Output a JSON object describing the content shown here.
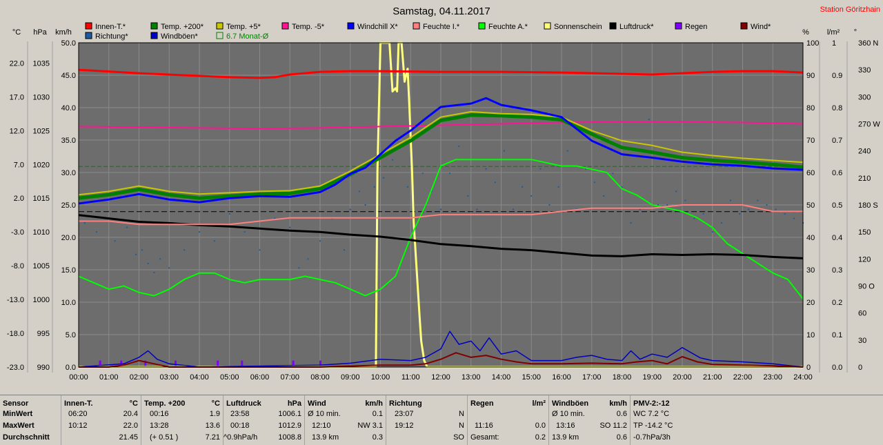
{
  "title": "Samstag, 04.11.2017",
  "station": "Station Göritzhain",
  "colors": {
    "plot_bg": "#6d6d6d",
    "grid": "#8a8a8a",
    "innen": "#ff0000",
    "temp200": "#008000",
    "temp5": "#c8c800",
    "tempm5": "#ff1493",
    "windchill": "#0000ff",
    "feuchte_i": "#ff8080",
    "feuchte_a": "#00ff00",
    "sonne": "#ffff80",
    "luftdruck": "#000000",
    "regen": "#8000ff",
    "wind": "#800000",
    "richtung": "#1e5aa0",
    "windboeen": "#0000c0",
    "monat": "#008000"
  },
  "legend": [
    {
      "label": "Innen-T.*",
      "color": "#ff0000"
    },
    {
      "label": "Temp. +200*",
      "color": "#008000"
    },
    {
      "label": "Temp. +5*",
      "color": "#c8c800"
    },
    {
      "label": "Temp. -5*",
      "color": "#ff1493"
    },
    {
      "label": "Windchill X*",
      "color": "#0000ff"
    },
    {
      "label": "Feuchte I.*",
      "color": "#ff8080"
    },
    {
      "label": "Feuchte A.*",
      "color": "#00ff00"
    },
    {
      "label": "Sonnenschein",
      "color": "#ffff80"
    },
    {
      "label": "Luftdruck*",
      "color": "#000000"
    },
    {
      "label": "Regen",
      "color": "#8000ff"
    },
    {
      "label": "Wind*",
      "color": "#800000"
    },
    {
      "label": "Richtung*",
      "color": "#1e5aa0"
    },
    {
      "label": "Windböen*",
      "color": "#0000c0"
    },
    {
      "label": "6.7 Monat-Ø",
      "color": "#008000",
      "outline": true
    }
  ],
  "axis_units": {
    "temp": "°C",
    "pressure": "hPa",
    "wind": "km/h",
    "percent": "%",
    "rain": "l/m²",
    "degree": "°"
  },
  "chart_data": {
    "type": "line",
    "x_ticks": [
      "00:00",
      "01:00",
      "02:00",
      "03:00",
      "04:00",
      "05:00",
      "06:00",
      "07:00",
      "08:00",
      "09:00",
      "10:00",
      "11:00",
      "12:00",
      "13:00",
      "14:00",
      "15:00",
      "16:00",
      "17:00",
      "18:00",
      "19:00",
      "20:00",
      "21:00",
      "22:00",
      "23:00",
      "24:00"
    ],
    "xlim": [
      0,
      24
    ],
    "temp_ticks": [
      "22.0",
      "17.0",
      "12.0",
      "7.0",
      "2.0",
      "-3.0",
      "-8.0",
      "-13.0",
      "-18.0",
      "-23.0"
    ],
    "temp_lim": [
      -23,
      25
    ],
    "pressure_ticks": [
      "1035",
      "1030",
      "1025",
      "1020",
      "1015",
      "1010",
      "1005",
      "1000",
      "995",
      "990"
    ],
    "pressure_lim": [
      990,
      1038
    ],
    "wind_ticks": [
      "50.0",
      "45.0",
      "40.0",
      "35.0",
      "30.0",
      "25.0",
      "20.0",
      "15.0",
      "10.0",
      "5.0",
      "0.0"
    ],
    "wind_lim": [
      0,
      50
    ],
    "percent_ticks": [
      "100",
      "90",
      "80",
      "70",
      "60",
      "50",
      "40",
      "30",
      "20",
      "10",
      "0"
    ],
    "percent_lim": [
      0,
      100
    ],
    "rain_ticks": [
      "1",
      "0.9",
      "0.8",
      "0.7",
      "0.6",
      "0.5",
      "0.4",
      "0.3",
      "0.2",
      "0.1",
      "0.0"
    ],
    "rain_lim": [
      0,
      1
    ],
    "degree_ticks": [
      "360 N",
      "330",
      "300",
      "270 W",
      "240",
      "210",
      "180 S",
      "150",
      "120",
      "90 O",
      "60",
      "30",
      "0"
    ],
    "degree_lim": [
      0,
      360
    ],
    "monat_avg": 6.7,
    "series": [
      {
        "name": "Innen-T.*",
        "key": "innen",
        "axis": "temp",
        "x": [
          0,
          2,
          4,
          5,
          6,
          6.5,
          7,
          8,
          9,
          10,
          12,
          14,
          16,
          18,
          19,
          20,
          21,
          22,
          23,
          24
        ],
        "y": [
          21.0,
          20.5,
          20.1,
          19.9,
          19.8,
          19.9,
          20.3,
          20.7,
          20.8,
          20.8,
          20.7,
          20.7,
          20.6,
          20.4,
          20.3,
          20.5,
          20.7,
          20.8,
          20.8,
          20.6
        ]
      },
      {
        "name": "Temp. +200*",
        "key": "temp200",
        "axis": "temp",
        "x": [
          0,
          1,
          2,
          3,
          4,
          5,
          6,
          7,
          8,
          9,
          10,
          11,
          12,
          13,
          14,
          15,
          16,
          17,
          18,
          19,
          20,
          21,
          22,
          23,
          24
        ],
        "y": [
          2.0,
          2.5,
          3.3,
          2.5,
          2.0,
          2.3,
          2.6,
          2.7,
          3.4,
          5.5,
          8.0,
          10.5,
          13.5,
          14.3,
          14.2,
          14.0,
          13.6,
          11.5,
          9.5,
          8.8,
          8.0,
          7.6,
          7.3,
          7.0,
          6.6
        ]
      },
      {
        "name": "Temp. +5*",
        "key": "temp5",
        "axis": "temp",
        "x": [
          0,
          1,
          2,
          3,
          4,
          5,
          6,
          7,
          8,
          9,
          10,
          11,
          12,
          13,
          14,
          15,
          16,
          17,
          18,
          19,
          20,
          21,
          22,
          23,
          24
        ],
        "y": [
          2.5,
          3.0,
          3.8,
          3.0,
          2.6,
          2.8,
          3.0,
          3.1,
          3.8,
          6.0,
          8.5,
          11.0,
          14.0,
          14.8,
          14.5,
          14.4,
          14.0,
          12.0,
          10.5,
          9.8,
          8.8,
          8.3,
          7.9,
          7.6,
          7.3
        ]
      },
      {
        "name": "Temp. -5*",
        "key": "tempm5",
        "axis": "temp",
        "x": [
          0,
          2,
          4,
          6,
          8,
          10,
          12,
          14,
          16,
          18,
          20,
          22,
          24
        ],
        "y": [
          12.6,
          12.5,
          12.4,
          12.3,
          12.4,
          12.6,
          12.8,
          13.0,
          13.2,
          13.3,
          13.3,
          13.2,
          13.0
        ]
      },
      {
        "name": "Windchill X*",
        "key": "windchill",
        "axis": "temp",
        "x": [
          0,
          1,
          2,
          3,
          4,
          5,
          6,
          7,
          8,
          8.5,
          9,
          9.5,
          10,
          10.5,
          11,
          11.5,
          12,
          13,
          13.5,
          14,
          15,
          16,
          17,
          18,
          19,
          20,
          21,
          22,
          23,
          24
        ],
        "y": [
          1.2,
          1.8,
          2.6,
          1.8,
          1.4,
          2.0,
          2.3,
          2.2,
          2.9,
          4.0,
          5.6,
          6.5,
          8.5,
          10.5,
          12.0,
          13.8,
          15.5,
          16.0,
          16.8,
          15.8,
          15.0,
          14.0,
          10.5,
          8.5,
          8.0,
          7.4,
          7.0,
          6.8,
          6.4,
          6.2
        ]
      },
      {
        "name": "Feuchte I.*",
        "key": "feuchte_i",
        "axis": "percent",
        "x": [
          0,
          1,
          2,
          3,
          4,
          5,
          6,
          7,
          7.5,
          8,
          9,
          10,
          11,
          12,
          13,
          14,
          15,
          16,
          17,
          18,
          19,
          20,
          21,
          22,
          23,
          24
        ],
        "y": [
          45,
          45,
          44,
          44,
          44,
          44,
          45,
          46,
          46,
          46,
          46,
          46,
          46,
          47,
          47,
          47,
          47,
          48,
          49,
          49,
          49,
          50,
          50,
          50,
          48,
          48
        ]
      },
      {
        "name": "Feuchte A.*",
        "key": "feuchte_a",
        "axis": "percent",
        "x": [
          0,
          0.5,
          1,
          1.5,
          2,
          2.5,
          3,
          3.5,
          4,
          4.5,
          5,
          5.5,
          6,
          6.5,
          7,
          7.5,
          8,
          8.5,
          9,
          9.5,
          10,
          10.5,
          11,
          11.5,
          12,
          12.5,
          13,
          14,
          15,
          16,
          16.5,
          17,
          17.5,
          18,
          18.5,
          19,
          19.5,
          20,
          20.5,
          21,
          21.5,
          22,
          22.5,
          23,
          23.5,
          24
        ],
        "y": [
          28,
          26,
          24,
          25,
          23,
          22,
          24,
          27,
          29,
          29,
          27,
          26,
          27,
          27,
          27,
          28,
          27,
          26,
          24,
          22,
          24,
          28,
          40,
          50,
          62,
          64,
          64,
          64,
          64,
          62,
          62,
          61,
          60,
          55,
          53,
          50,
          49,
          48,
          46,
          43,
          38,
          35,
          32,
          29,
          27,
          21
        ]
      },
      {
        "name": "Sonnenschein",
        "key": "sonne",
        "axis": "percent",
        "x": [
          0,
          9.85,
          9.9,
          10.0,
          10.05,
          10.15,
          10.3,
          10.4,
          10.5,
          10.55,
          10.6,
          10.7,
          10.8,
          10.9,
          10.95,
          11.05,
          11.1,
          11.2,
          11.3,
          11.35,
          11.45,
          11.55,
          11.6,
          12,
          24
        ],
        "y": [
          0,
          0,
          60,
          100,
          100,
          100,
          100,
          85,
          86,
          85,
          100,
          100,
          88,
          92,
          82,
          60,
          45,
          30,
          15,
          8,
          2,
          0,
          0,
          0,
          0
        ]
      },
      {
        "name": "Luftdruck*",
        "key": "luftdruck",
        "axis": "pressure",
        "x": [
          0,
          1,
          2,
          3,
          4,
          5,
          6,
          7,
          8,
          9,
          10,
          11,
          12,
          13,
          14,
          15,
          16,
          17,
          18,
          19,
          20,
          21,
          22,
          23,
          24
        ],
        "y": [
          1012.5,
          1012.0,
          1011.5,
          1011.3,
          1011.0,
          1010.8,
          1010.5,
          1010.2,
          1010.0,
          1009.6,
          1009.3,
          1008.8,
          1008.2,
          1007.9,
          1007.5,
          1007.3,
          1006.9,
          1006.5,
          1006.4,
          1006.7,
          1006.6,
          1006.7,
          1006.6,
          1006.3,
          1006.1
        ]
      },
      {
        "name": "Wind*",
        "key": "wind",
        "axis": "wind",
        "x": [
          0,
          1,
          1.5,
          2,
          2.5,
          3,
          4,
          8,
          10,
          11,
          11.5,
          12,
          12.5,
          13,
          13.5,
          14,
          14.5,
          15,
          16,
          17,
          18,
          18.5,
          19,
          19.5,
          20,
          20.5,
          21,
          22,
          23,
          24
        ],
        "y": [
          0,
          0,
          0.3,
          1.0,
          0.5,
          0,
          0,
          0,
          0.3,
          0.3,
          0.5,
          1.2,
          2.2,
          1.5,
          1.8,
          1.2,
          0.8,
          0.5,
          0.5,
          0.6,
          0.5,
          0.8,
          1.0,
          0.5,
          1.6,
          0.8,
          0.4,
          0.3,
          0.2,
          0
        ]
      },
      {
        "name": "Windböen*",
        "key": "windboeen",
        "axis": "wind",
        "x": [
          0,
          1.5,
          2,
          2.3,
          2.6,
          3,
          4,
          8,
          9,
          10,
          11,
          11.5,
          12,
          12.3,
          12.6,
          13,
          13.3,
          13.6,
          14,
          14.5,
          15,
          16,
          16.5,
          17,
          17.5,
          18,
          18.3,
          18.6,
          19,
          19.5,
          20,
          20.3,
          20.6,
          21,
          22,
          23,
          24
        ],
        "y": [
          0,
          0.5,
          1.5,
          2.5,
          1.2,
          0.5,
          0,
          0.3,
          0.6,
          1.2,
          1.0,
          1.5,
          2.8,
          5.5,
          3.5,
          4.0,
          2.5,
          4.5,
          2.0,
          2.5,
          1.0,
          1.0,
          1.5,
          1.8,
          1.2,
          1.0,
          2.5,
          1.2,
          2.0,
          1.5,
          3.0,
          2.2,
          1.4,
          1.0,
          0.8,
          0.5,
          0
        ]
      }
    ],
    "richtung_points": [
      [
        0.2,
        160
      ],
      [
        0.6,
        150
      ],
      [
        1.2,
        140
      ],
      [
        1.6,
        155
      ],
      [
        1.9,
        125
      ],
      [
        2.1,
        130
      ],
      [
        2.3,
        115
      ],
      [
        2.5,
        105
      ],
      [
        2.7,
        120
      ],
      [
        3.0,
        110
      ],
      [
        3.5,
        130
      ],
      [
        4.0,
        150
      ],
      [
        4.5,
        140
      ],
      [
        5.0,
        170
      ],
      [
        5.5,
        150
      ],
      [
        6.0,
        130
      ],
      [
        6.5,
        165
      ],
      [
        7.0,
        155
      ],
      [
        7.3,
        110
      ],
      [
        7.6,
        120
      ],
      [
        8.0,
        140
      ],
      [
        8.4,
        165
      ],
      [
        8.8,
        130
      ],
      [
        9.0,
        175
      ],
      [
        9.3,
        195
      ],
      [
        9.5,
        180
      ],
      [
        9.8,
        200
      ],
      [
        10.1,
        210
      ],
      [
        10.4,
        230
      ],
      [
        10.6,
        245
      ],
      [
        10.9,
        200
      ],
      [
        11.1,
        180
      ],
      [
        11.4,
        215
      ],
      [
        11.7,
        195
      ],
      [
        12.0,
        175
      ],
      [
        12.3,
        215
      ],
      [
        12.6,
        245
      ],
      [
        12.9,
        190
      ],
      [
        13.2,
        175
      ],
      [
        13.5,
        220
      ],
      [
        13.8,
        205
      ],
      [
        14.1,
        240
      ],
      [
        14.4,
        175
      ],
      [
        14.7,
        200
      ],
      [
        15.0,
        190
      ],
      [
        15.3,
        220
      ],
      [
        15.6,
        180
      ],
      [
        15.9,
        200
      ],
      [
        16.2,
        240
      ],
      [
        16.5,
        175
      ],
      [
        16.8,
        220
      ],
      [
        17.1,
        205
      ],
      [
        17.4,
        190
      ],
      [
        17.7,
        215
      ],
      [
        18.0,
        200
      ],
      [
        18.3,
        160
      ],
      [
        18.6,
        175
      ],
      [
        18.9,
        275
      ],
      [
        19.2,
        180
      ],
      [
        19.5,
        180
      ],
      [
        19.8,
        195
      ],
      [
        20.1,
        185
      ],
      [
        20.4,
        165
      ],
      [
        20.7,
        170
      ],
      [
        21.0,
        150
      ],
      [
        21.3,
        160
      ],
      [
        21.6,
        185
      ],
      [
        21.9,
        170
      ],
      [
        22.2,
        175
      ],
      [
        22.5,
        185
      ],
      [
        22.8,
        180
      ],
      [
        23.1,
        175
      ],
      [
        23.4,
        170
      ],
      [
        23.7,
        165
      ],
      [
        24.0,
        160
      ]
    ],
    "regen_bars": [
      [
        0.7,
        0.02
      ],
      [
        1.4,
        0.02
      ],
      [
        2.2,
        0.02
      ],
      [
        3.2,
        0.02
      ],
      [
        4.6,
        0.02
      ],
      [
        5.4,
        0.02
      ],
      [
        7.1,
        0.02
      ],
      [
        8.0,
        0.02
      ]
    ]
  },
  "summary": {
    "sensor": {
      "h": "Sensor",
      "r1": "MinWert",
      "r2": "MaxWert",
      "r3": "Durchschnitt"
    },
    "innen": {
      "h": "Innen-T.",
      "u": "°C",
      "r1": [
        "06:20",
        "20.4"
      ],
      "r2": [
        "10:12",
        "22.0"
      ],
      "r3": [
        "",
        "21.45"
      ]
    },
    "temp200": {
      "h": "Temp. +200",
      "u": "°C",
      "r1": [
        "00:16",
        "1.9"
      ],
      "r2": [
        "13:28",
        "13.6"
      ],
      "r3": [
        "(+ 0.51 )",
        "7.21"
      ]
    },
    "luftdruck": {
      "h": "Luftdruck",
      "u": "hPa",
      "r1": [
        "23:58",
        "1006.1"
      ],
      "r2": [
        "00:18",
        "1012.9"
      ],
      "r3": [
        "^0.9hPa/h",
        "1008.8"
      ]
    },
    "wind": {
      "h": "Wind",
      "u": "km/h",
      "r1": [
        "Ø 10 min.",
        "0.1"
      ],
      "r2": [
        "12:10",
        "NW 3.1"
      ],
      "r3": [
        "13.9 km",
        "0.3"
      ]
    },
    "richtung": {
      "h": "Richtung",
      "u": "",
      "r1": [
        "23:07",
        "N"
      ],
      "r2": [
        "19:12",
        "N"
      ],
      "r3": [
        "",
        "SO"
      ]
    },
    "regen": {
      "h": "Regen",
      "u": "l/m²",
      "r1": [
        "",
        ""
      ],
      "r2": [
        "11:16",
        "0.0"
      ],
      "r3": [
        "Gesamt:",
        "0.2"
      ]
    },
    "windboeen": {
      "h": "Windböen",
      "u": "km/h",
      "r1": [
        "Ø 10 min.",
        "0.6"
      ],
      "r2": [
        "13:16",
        "SO 11.2"
      ],
      "r3": [
        "13.9 km",
        "0.6"
      ]
    },
    "pmv": {
      "h": "PMV-2:-12",
      "r1": "WC 7.2 °C",
      "r2": "TP -14.2 °C",
      "r3": "-0.7hPa/3h"
    }
  }
}
